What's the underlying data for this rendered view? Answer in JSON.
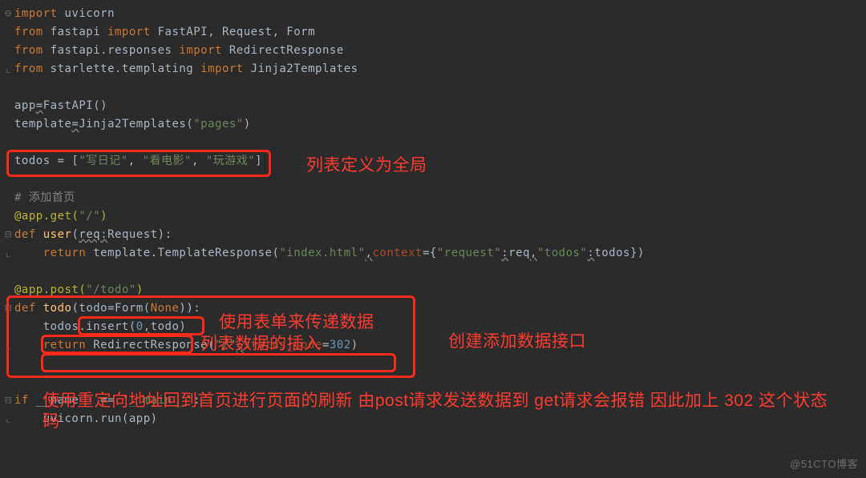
{
  "code": {
    "l1_import": "import",
    "l1_mod": " uvicorn",
    "l2_from": "from",
    "l2_mod": " fastapi ",
    "l2_import": "import",
    "l2_rest": " FastAPI, Request, Form",
    "l3_from": "from",
    "l3_mod": " fastapi.responses ",
    "l3_import": "import",
    "l3_rest": " RedirectResponse",
    "l4_from": "from",
    "l4_mod": " starlette.templating ",
    "l4_import": "import",
    "l4_rest": " Jinja2Templates",
    "l6_a": "app",
    "l6_b": "=",
    "l6_c": "FastAPI()",
    "l7_a": "template",
    "l7_b": "=",
    "l7_c": "Jinja2Templates(",
    "l7_str": "\"pages\"",
    "l7_end": ")",
    "l9_a": "todos = [",
    "l9_s1": "\"写日记\"",
    "l9_c1": ", ",
    "l9_s2": "\"看电影\"",
    "l9_c2": ", ",
    "l9_s3": "\"玩游戏\"",
    "l9_end": "]",
    "l11_comment": "# 添加首页",
    "l12_dec": "@app.get",
    "l12_paren_o": "(",
    "l12_str": "\"/\"",
    "l12_paren_c": ")",
    "l13_def": "def",
    "l13_fn": " user",
    "l13_sig_o": "(",
    "l13_p1": "req",
    "l13_colon": ":",
    "l13_ptype": "Request",
    "l13_sig_c": "):",
    "l14_ret": "return",
    "l14_rest_a": " template.TemplateResponse(",
    "l14_str1": "\"index.html\"",
    "l14_comma": ",",
    "l14_kw1": "context",
    "l14_eq1": "={",
    "l14_str2": "\"request\"",
    "l14_colon1": ":",
    "l14_var1": "req",
    "l14_comma2": ",",
    "l14_str3": "\"todos\"",
    "l14_colon2": ":",
    "l14_var2": "todos",
    "l14_end": "})",
    "l16_dec": "@app.post",
    "l16_paren_o": "(",
    "l16_str": "\"/todo\"",
    "l16_paren_c": ")",
    "l17_def": "def",
    "l17_fn": " todo",
    "l17_sig_o": "(",
    "l17_p1": "todo",
    "l17_eq": "=",
    "l17_form": "Form(",
    "l17_none": "None",
    "l17_form_c": ")",
    "l17_sig_c": "):",
    "l18_a": "todos.insert(",
    "l18_n": "0",
    "l18_c": ",",
    "l18_v": "todo",
    "l18_e": ")",
    "l19_ret": "return",
    "l19_a": " RedirectResponse(",
    "l19_str": "\"/\"",
    "l19_c": ",",
    "l19_kw": "status_code",
    "l19_eq": "=",
    "l19_n": "302",
    "l19_e": ")",
    "l22_if": "if",
    "l22_a": " __name__ == ",
    "l22_str": "'__main__'",
    "l22_c": ":",
    "l23_a": "uvicorn.run(",
    "l23_v": "app",
    "l23_e": ")"
  },
  "annotations": {
    "a1": "列表定义为全局",
    "a2": "使用表单来传递数据",
    "a3": "列表数据的插入",
    "a4": "创建添加数据接口",
    "a5": "使用重定向地址回到首页进行页面的刷新 由post请求发送数据到 get请求会报错 因此加上 302 这个状态码"
  },
  "watermark": "@51CTO博客"
}
